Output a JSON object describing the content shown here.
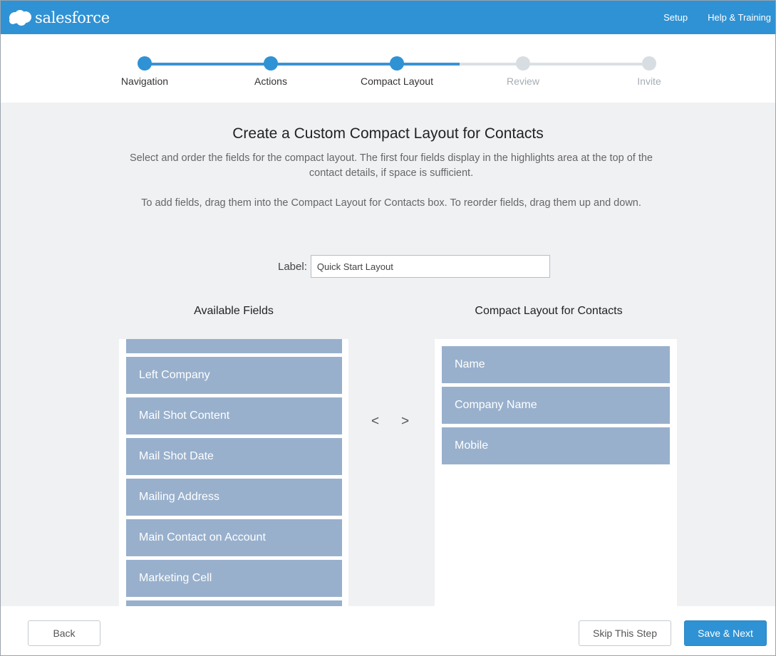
{
  "header": {
    "logo_text": "salesforce",
    "links": [
      "Setup",
      "Help & Training"
    ]
  },
  "steps": [
    {
      "label": "Navigation",
      "status": "done"
    },
    {
      "label": "Actions",
      "status": "done"
    },
    {
      "label": "Compact Layout",
      "status": "current"
    },
    {
      "label": "Review",
      "status": "todo"
    },
    {
      "label": "Invite",
      "status": "todo"
    }
  ],
  "main": {
    "title": "Create a Custom Compact Layout for Contacts",
    "description1": "Select and order the fields for the compact layout. The first four fields display in the highlights area at the top of the contact details, if space is sufficient.",
    "description2": "To add fields, drag them into the Compact Layout for Contacts box. To reorder fields, drag them up and down.",
    "label_text": "Label:",
    "label_value": "Quick Start Layout",
    "available_title": "Available Fields",
    "layout_title": "Compact Layout for Contacts",
    "available_fields": [
      "",
      "Left Company",
      "Mail Shot Content",
      "Mail Shot Date",
      "Mailing Address",
      "Main Contact on Account",
      "Marketing Cell",
      ""
    ],
    "layout_fields": [
      "Name",
      "Company Name",
      "Mobile"
    ],
    "move_left": "<",
    "move_right": ">"
  },
  "footer": {
    "back": "Back",
    "skip": "Skip This Step",
    "next": "Save & Next"
  },
  "colors": {
    "brand": "#2f92d4",
    "field": "#98b0cc",
    "step_todo": "#d8dde2"
  }
}
